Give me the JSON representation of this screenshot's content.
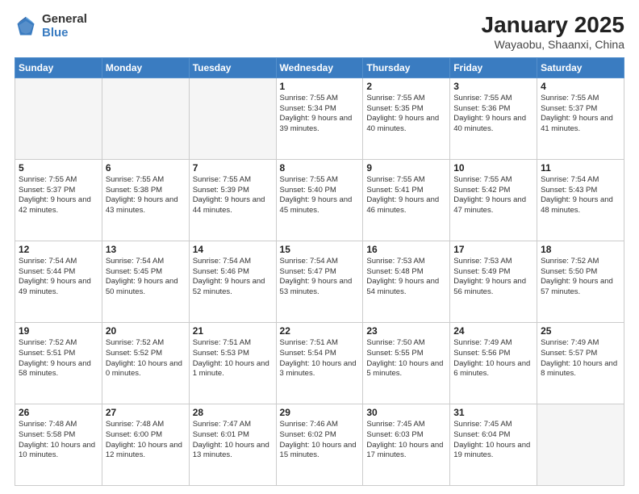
{
  "logo": {
    "general": "General",
    "blue": "Blue"
  },
  "header": {
    "title": "January 2025",
    "subtitle": "Wayaobu, Shaanxi, China"
  },
  "weekdays": [
    "Sunday",
    "Monday",
    "Tuesday",
    "Wednesday",
    "Thursday",
    "Friday",
    "Saturday"
  ],
  "weeks": [
    [
      {
        "day": "",
        "info": ""
      },
      {
        "day": "",
        "info": ""
      },
      {
        "day": "",
        "info": ""
      },
      {
        "day": "1",
        "info": "Sunrise: 7:55 AM\nSunset: 5:34 PM\nDaylight: 9 hours\nand 39 minutes."
      },
      {
        "day": "2",
        "info": "Sunrise: 7:55 AM\nSunset: 5:35 PM\nDaylight: 9 hours\nand 40 minutes."
      },
      {
        "day": "3",
        "info": "Sunrise: 7:55 AM\nSunset: 5:36 PM\nDaylight: 9 hours\nand 40 minutes."
      },
      {
        "day": "4",
        "info": "Sunrise: 7:55 AM\nSunset: 5:37 PM\nDaylight: 9 hours\nand 41 minutes."
      }
    ],
    [
      {
        "day": "5",
        "info": "Sunrise: 7:55 AM\nSunset: 5:37 PM\nDaylight: 9 hours\nand 42 minutes."
      },
      {
        "day": "6",
        "info": "Sunrise: 7:55 AM\nSunset: 5:38 PM\nDaylight: 9 hours\nand 43 minutes."
      },
      {
        "day": "7",
        "info": "Sunrise: 7:55 AM\nSunset: 5:39 PM\nDaylight: 9 hours\nand 44 minutes."
      },
      {
        "day": "8",
        "info": "Sunrise: 7:55 AM\nSunset: 5:40 PM\nDaylight: 9 hours\nand 45 minutes."
      },
      {
        "day": "9",
        "info": "Sunrise: 7:55 AM\nSunset: 5:41 PM\nDaylight: 9 hours\nand 46 minutes."
      },
      {
        "day": "10",
        "info": "Sunrise: 7:55 AM\nSunset: 5:42 PM\nDaylight: 9 hours\nand 47 minutes."
      },
      {
        "day": "11",
        "info": "Sunrise: 7:54 AM\nSunset: 5:43 PM\nDaylight: 9 hours\nand 48 minutes."
      }
    ],
    [
      {
        "day": "12",
        "info": "Sunrise: 7:54 AM\nSunset: 5:44 PM\nDaylight: 9 hours\nand 49 minutes."
      },
      {
        "day": "13",
        "info": "Sunrise: 7:54 AM\nSunset: 5:45 PM\nDaylight: 9 hours\nand 50 minutes."
      },
      {
        "day": "14",
        "info": "Sunrise: 7:54 AM\nSunset: 5:46 PM\nDaylight: 9 hours\nand 52 minutes."
      },
      {
        "day": "15",
        "info": "Sunrise: 7:54 AM\nSunset: 5:47 PM\nDaylight: 9 hours\nand 53 minutes."
      },
      {
        "day": "16",
        "info": "Sunrise: 7:53 AM\nSunset: 5:48 PM\nDaylight: 9 hours\nand 54 minutes."
      },
      {
        "day": "17",
        "info": "Sunrise: 7:53 AM\nSunset: 5:49 PM\nDaylight: 9 hours\nand 56 minutes."
      },
      {
        "day": "18",
        "info": "Sunrise: 7:52 AM\nSunset: 5:50 PM\nDaylight: 9 hours\nand 57 minutes."
      }
    ],
    [
      {
        "day": "19",
        "info": "Sunrise: 7:52 AM\nSunset: 5:51 PM\nDaylight: 9 hours\nand 58 minutes."
      },
      {
        "day": "20",
        "info": "Sunrise: 7:52 AM\nSunset: 5:52 PM\nDaylight: 10 hours\nand 0 minutes."
      },
      {
        "day": "21",
        "info": "Sunrise: 7:51 AM\nSunset: 5:53 PM\nDaylight: 10 hours\nand 1 minute."
      },
      {
        "day": "22",
        "info": "Sunrise: 7:51 AM\nSunset: 5:54 PM\nDaylight: 10 hours\nand 3 minutes."
      },
      {
        "day": "23",
        "info": "Sunrise: 7:50 AM\nSunset: 5:55 PM\nDaylight: 10 hours\nand 5 minutes."
      },
      {
        "day": "24",
        "info": "Sunrise: 7:49 AM\nSunset: 5:56 PM\nDaylight: 10 hours\nand 6 minutes."
      },
      {
        "day": "25",
        "info": "Sunrise: 7:49 AM\nSunset: 5:57 PM\nDaylight: 10 hours\nand 8 minutes."
      }
    ],
    [
      {
        "day": "26",
        "info": "Sunrise: 7:48 AM\nSunset: 5:58 PM\nDaylight: 10 hours\nand 10 minutes."
      },
      {
        "day": "27",
        "info": "Sunrise: 7:48 AM\nSunset: 6:00 PM\nDaylight: 10 hours\nand 12 minutes."
      },
      {
        "day": "28",
        "info": "Sunrise: 7:47 AM\nSunset: 6:01 PM\nDaylight: 10 hours\nand 13 minutes."
      },
      {
        "day": "29",
        "info": "Sunrise: 7:46 AM\nSunset: 6:02 PM\nDaylight: 10 hours\nand 15 minutes."
      },
      {
        "day": "30",
        "info": "Sunrise: 7:45 AM\nSunset: 6:03 PM\nDaylight: 10 hours\nand 17 minutes."
      },
      {
        "day": "31",
        "info": "Sunrise: 7:45 AM\nSunset: 6:04 PM\nDaylight: 10 hours\nand 19 minutes."
      },
      {
        "day": "",
        "info": ""
      }
    ]
  ]
}
